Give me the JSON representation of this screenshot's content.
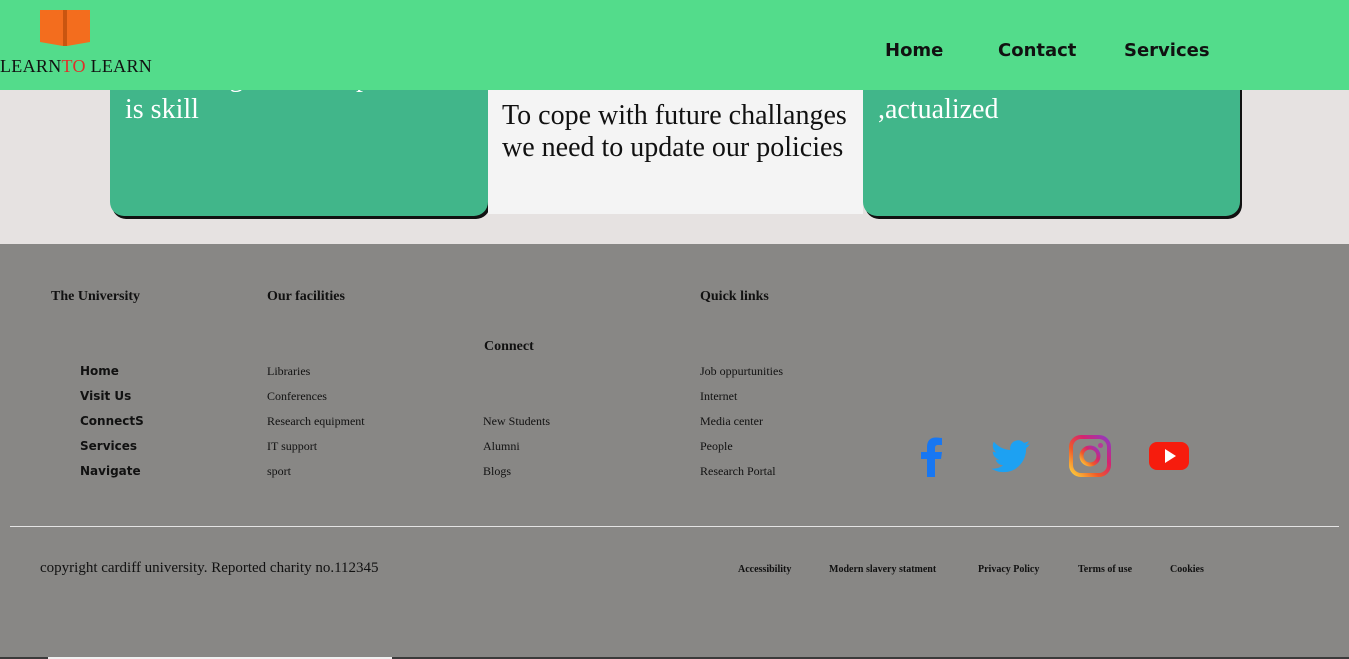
{
  "header": {
    "logo_part1": "LEARN",
    "logo_part2": "TO",
    "logo_part3": " LEARN",
    "nav": [
      "Home",
      "Contact",
      "Services"
    ],
    "colors": {
      "background": "#53dc8b",
      "logo_icon": "#f36d1e",
      "logo_accent": "#e0302a"
    }
  },
  "cards": [
    {
      "text": "knowlledge and its apllication is skill"
    },
    {
      "text": "To cope with future challanges we need to update our policies"
    },
    {
      "text": "should be self-consciousness ,actualized"
    }
  ],
  "footer": {
    "headings": {
      "university": "The University",
      "facilities": "Our facilities",
      "connect": "Connect",
      "quick_links": "Quick links"
    },
    "university_links": [
      "Home",
      "Visit Us",
      "ConnectS",
      "Services",
      "Navigate"
    ],
    "facilities_links": [
      "Libraries",
      "Conferences",
      "Research equipment",
      "IT support",
      "sport"
    ],
    "connect_links": [
      "New Students",
      "Alumni",
      "Blogs"
    ],
    "quick_links": [
      "Job oppurtunities",
      "Internet",
      "Media center",
      "People",
      "Research Portal"
    ],
    "social_icons": [
      "facebook-icon",
      "twitter-icon",
      "instagram-icon",
      "youtube-icon"
    ],
    "copyright": "copyright cardiff university. Reported charity no.112345",
    "legal_links": [
      "Accessibility",
      "Modern slavery statment",
      "Privacy Policy",
      "Terms of use",
      "Cookies"
    ],
    "colors": {
      "background": "#888785",
      "card_green": "#41b68a"
    }
  }
}
